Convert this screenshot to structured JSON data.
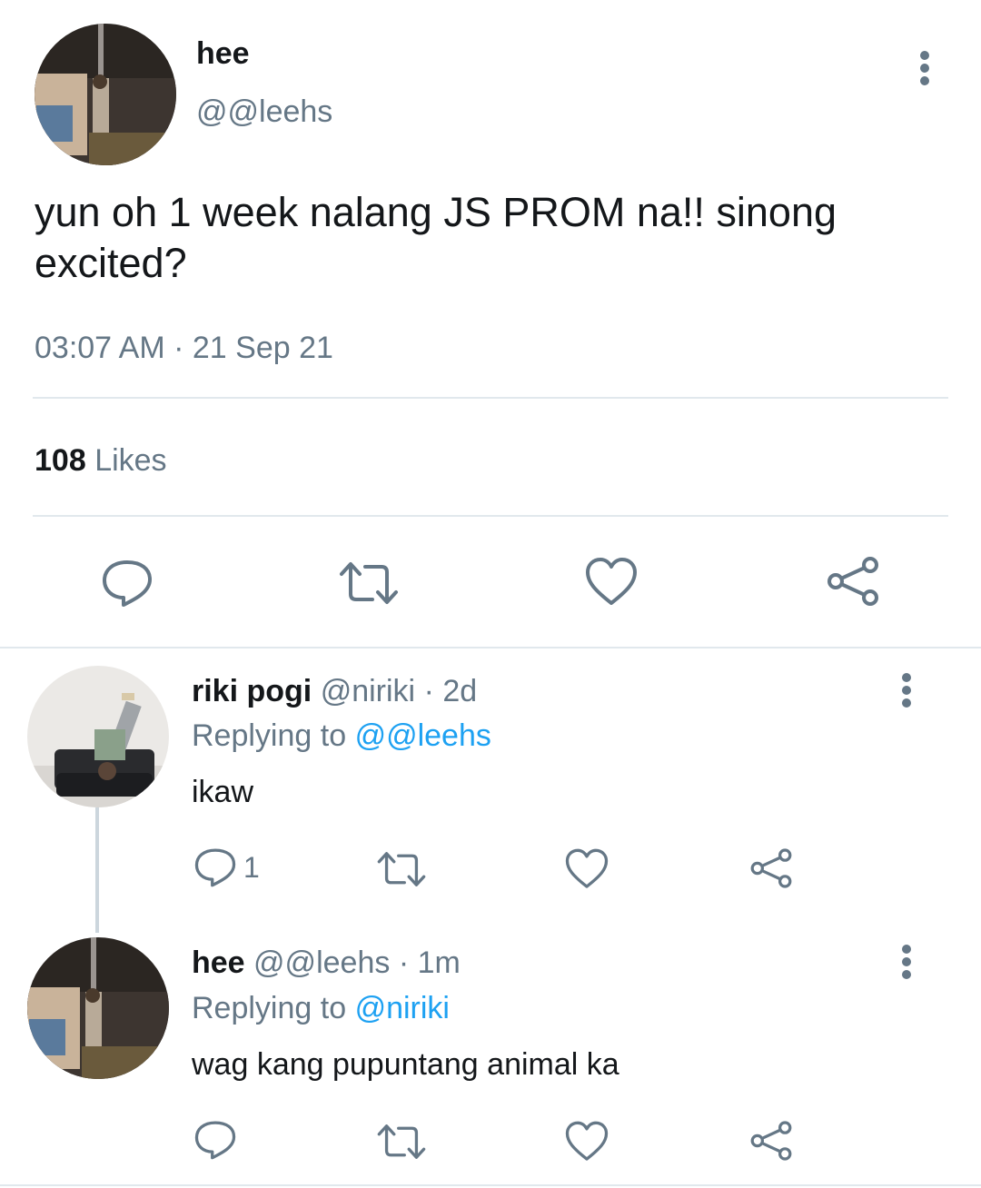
{
  "main_tweet": {
    "author_name": "hee",
    "author_handle": "@@leehs",
    "text": "yun oh 1 week nalang JS PROM na!! sinong excited?",
    "time": "03:07 AM",
    "separator": "·",
    "date": "21 Sep 21",
    "likes_count": "108",
    "likes_label": "Likes",
    "actions": [
      "reply-icon",
      "retweet-icon",
      "like-icon",
      "share-icon"
    ]
  },
  "replies": [
    {
      "author_name": "riki pogi",
      "author_handle": "@niriki",
      "age": "· 2d",
      "replying_to_label": "Replying to",
      "replying_to": "@@leehs",
      "text": "ikaw",
      "reply_count": "1"
    },
    {
      "author_name": "hee",
      "author_handle": "@@leehs",
      "age": "· 1m",
      "replying_to_label": "Replying to",
      "replying_to": "@niriki",
      "text": "wag kang pupuntang animal ka",
      "reply_count": ""
    }
  ],
  "colors": {
    "text": "#14171a",
    "secondary": "#657786",
    "link": "#1da1f2",
    "divider": "#e1e8ed"
  }
}
